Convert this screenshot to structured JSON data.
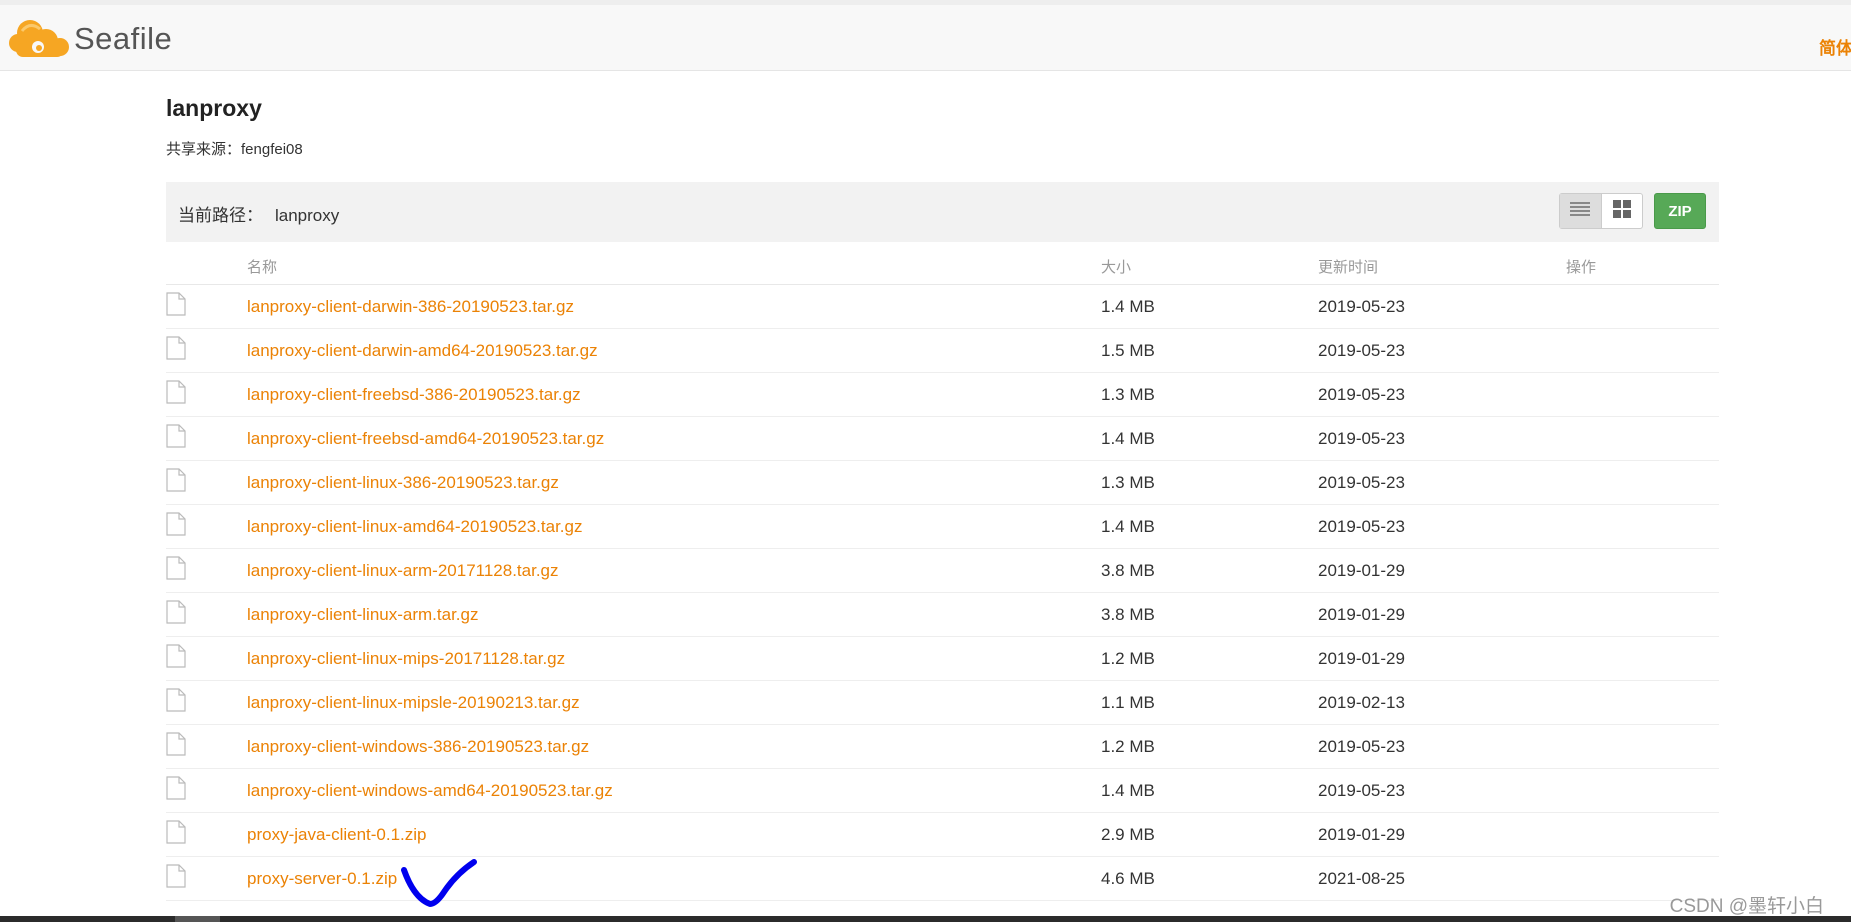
{
  "app": {
    "logo_text": "Seafile",
    "language_link": "简体中文"
  },
  "repo": {
    "name": "lanproxy",
    "share_from": "共享来源：fengfei08"
  },
  "path_bar": {
    "label": "当前路径：",
    "repo_name": "lanproxy",
    "zip_label": "ZIP"
  },
  "table": {
    "headers": {
      "name": "名称",
      "size": "大小",
      "time": "更新时间",
      "ops": "操作"
    },
    "rows": [
      {
        "name": "lanproxy-client-darwin-386-20190523.tar.gz",
        "size": "1.4 MB",
        "time": "2019-05-23"
      },
      {
        "name": "lanproxy-client-darwin-amd64-20190523.tar.gz",
        "size": "1.5 MB",
        "time": "2019-05-23"
      },
      {
        "name": "lanproxy-client-freebsd-386-20190523.tar.gz",
        "size": "1.3 MB",
        "time": "2019-05-23"
      },
      {
        "name": "lanproxy-client-freebsd-amd64-20190523.tar.gz",
        "size": "1.4 MB",
        "time": "2019-05-23"
      },
      {
        "name": "lanproxy-client-linux-386-20190523.tar.gz",
        "size": "1.3 MB",
        "time": "2019-05-23"
      },
      {
        "name": "lanproxy-client-linux-amd64-20190523.tar.gz",
        "size": "1.4 MB",
        "time": "2019-05-23"
      },
      {
        "name": "lanproxy-client-linux-arm-20171128.tar.gz",
        "size": "3.8 MB",
        "time": "2019-01-29"
      },
      {
        "name": "lanproxy-client-linux-arm.tar.gz",
        "size": "3.8 MB",
        "time": "2019-01-29"
      },
      {
        "name": "lanproxy-client-linux-mips-20171128.tar.gz",
        "size": "1.2 MB",
        "time": "2019-01-29"
      },
      {
        "name": "lanproxy-client-linux-mipsle-20190213.tar.gz",
        "size": "1.1 MB",
        "time": "2019-02-13"
      },
      {
        "name": "lanproxy-client-windows-386-20190523.tar.gz",
        "size": "1.2 MB",
        "time": "2019-05-23"
      },
      {
        "name": "lanproxy-client-windows-amd64-20190523.tar.gz",
        "size": "1.4 MB",
        "time": "2019-05-23"
      },
      {
        "name": "proxy-java-client-0.1.zip",
        "size": "2.9 MB",
        "time": "2019-01-29"
      },
      {
        "name": "proxy-server-0.1.zip",
        "size": "4.6 MB",
        "time": "2021-08-25"
      }
    ]
  },
  "watermark": "CSDN @墨轩小白",
  "colors": {
    "accent": "#eb8205",
    "zip_green": "#57a957",
    "annotation_blue": "#0000ee"
  }
}
